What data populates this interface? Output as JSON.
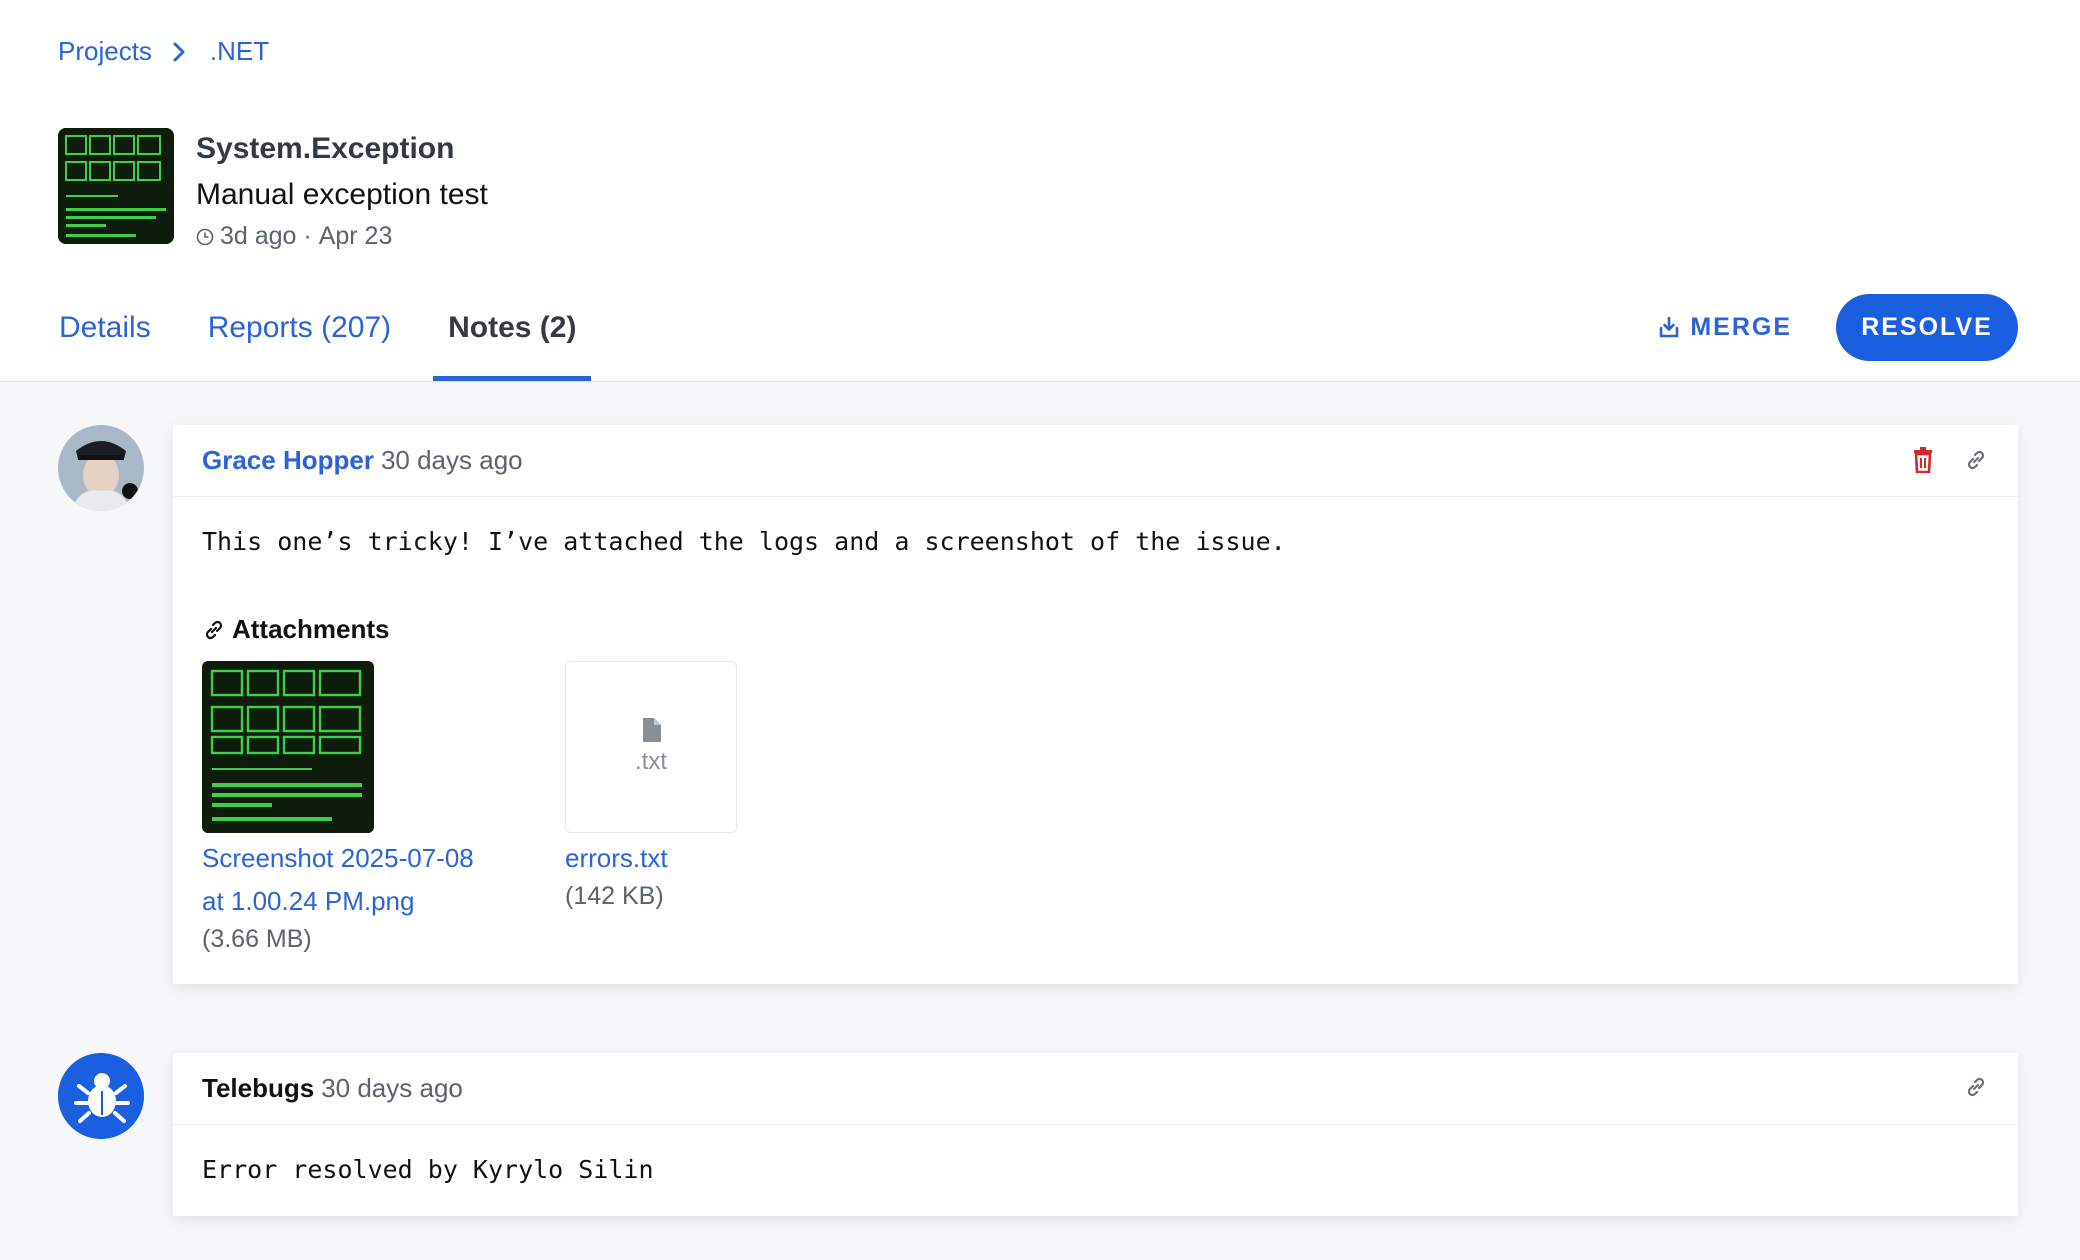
{
  "breadcrumb": {
    "root": "Projects",
    "current": ".NET"
  },
  "error": {
    "type": "System.Exception",
    "message": "Manual exception test",
    "relative_time": "3d ago",
    "separator": " · ",
    "date": "Apr 23"
  },
  "tabs": [
    {
      "label": "Details"
    },
    {
      "label": "Reports (207)"
    },
    {
      "label": "Notes (2)"
    }
  ],
  "actions": {
    "merge": "MERGE",
    "resolve": "RESOLVE"
  },
  "notes": [
    {
      "author": "Grace Hopper",
      "time": "30 days ago",
      "text": "This one’s tricky! I’ve attached the logs and a screenshot of the issue.",
      "attachments_title": "Attachments",
      "attachments": [
        {
          "name": "Screenshot 2025-07-08 at 1.00.24 PM.png",
          "size": "(3.66 MB)"
        },
        {
          "name": "errors.txt",
          "size": "(142 KB)",
          "ext": ".txt"
        }
      ]
    },
    {
      "author": "Telebugs",
      "time": "30 days ago",
      "text": "Error resolved by Kyrylo Silin"
    }
  ],
  "colors": {
    "accent": "#2b63d9",
    "resolve": "#1a5fe0",
    "delete": "#d22a2a"
  }
}
